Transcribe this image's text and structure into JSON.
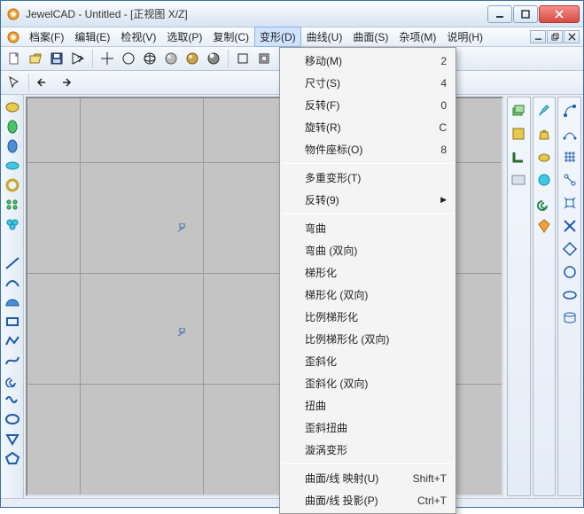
{
  "title": "JewelCAD - Untitled - [正视图 X/Z]",
  "menubar": [
    "档案(F)",
    "编辑(E)",
    "检视(V)",
    "选取(P)",
    "复制(C)",
    "变形(D)",
    "曲线(U)",
    "曲面(S)",
    "杂项(M)",
    "说明(H)"
  ],
  "active_menu_index": 5,
  "dropdown": {
    "groups": [
      [
        {
          "label": "移动(M)",
          "shortcut": "2"
        },
        {
          "label": "尺寸(S)",
          "shortcut": "4"
        },
        {
          "label": "反转(F)",
          "shortcut": "0"
        },
        {
          "label": "旋转(R)",
          "shortcut": "C"
        },
        {
          "label": "物件座标(O)",
          "shortcut": "8"
        }
      ],
      [
        {
          "label": "多重变形(T)"
        },
        {
          "label": "反转(9)",
          "submenu": true
        }
      ],
      [
        {
          "label": "弯曲"
        },
        {
          "label": "弯曲 (双向)"
        },
        {
          "label": "梯形化"
        },
        {
          "label": "梯形化 (双向)"
        },
        {
          "label": "比例梯形化"
        },
        {
          "label": "比例梯形化 (双向)"
        },
        {
          "label": "歪斜化"
        },
        {
          "label": "歪斜化 (双向)"
        },
        {
          "label": "扭曲"
        },
        {
          "label": "歪斜扭曲"
        },
        {
          "label": "漩涡变形"
        }
      ],
      [
        {
          "label": "曲面/线 映射(U)",
          "shortcut": "Shift+T"
        },
        {
          "label": "曲面/线 投影(P)",
          "shortcut": "Ctrl+T"
        }
      ]
    ]
  }
}
